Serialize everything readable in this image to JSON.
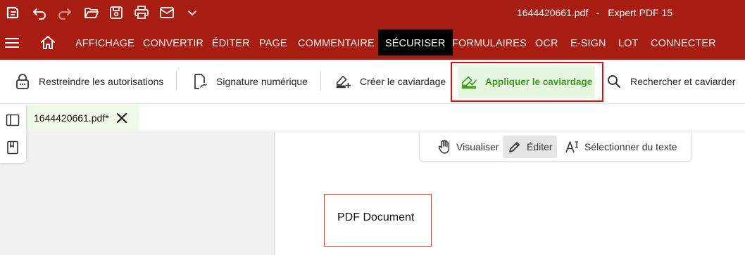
{
  "window": {
    "title": "1644420661.pdf   -   Expert PDF 15"
  },
  "quick_access": [
    {
      "name": "app-logo-icon"
    },
    {
      "name": "undo-icon"
    },
    {
      "name": "redo-icon"
    },
    {
      "name": "open-folder-icon"
    },
    {
      "name": "save-icon"
    },
    {
      "name": "print-icon"
    },
    {
      "name": "email-icon"
    },
    {
      "name": "chevron-down-icon"
    }
  ],
  "menu": {
    "tabs": [
      "AFFICHAGE",
      "CONVERTIR",
      "ÉDITER",
      "PAGE",
      "COMMENTAIRE",
      "SÉCURISER",
      "FORMULAIRES",
      "OCR",
      "E-SIGN",
      "LOT",
      "CONNECTER"
    ],
    "active_tab": "SÉCURISER"
  },
  "ribbon": {
    "restrict": "Restreindre les autorisations",
    "signature": "Signature numérique",
    "create_redaction": "Créer le caviardage",
    "apply_redaction": "Appliquer le caviardage",
    "search_redact": "Rechercher et caviarder"
  },
  "document_tab": {
    "label": "1644420661.pdf*"
  },
  "mode_bar": {
    "view": "Visualiser",
    "edit": "Éditer",
    "select_text": "Sélectionner du texte",
    "active": "Éditer"
  },
  "page": {
    "redaction_text": "PDF Document"
  },
  "colors": {
    "brand": "#a71d12",
    "active_tab": "#000000",
    "highlight_border": "#d61010",
    "apply_green": "#3f9a1d",
    "redaction_border": "#d93a2b"
  }
}
